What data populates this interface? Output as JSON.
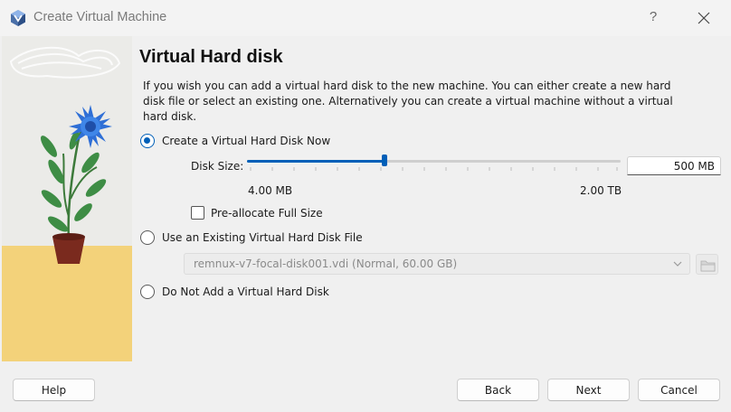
{
  "window": {
    "title": "Create Virtual Machine",
    "help_symbol": "?",
    "icons": {
      "app": "virtualbox-icon",
      "close": "close-icon"
    }
  },
  "page": {
    "heading": "Virtual Hard disk",
    "description": "If you wish you can add a virtual hard disk to the new machine. You can either create a new hard disk file or select an existing one. Alternatively you can create a virtual machine without a virtual hard disk."
  },
  "options": {
    "create_now": {
      "label": "Create a Virtual Hard Disk Now",
      "selected": true
    },
    "use_existing": {
      "label": "Use an Existing Virtual Hard Disk File",
      "selected": false
    },
    "do_not_add": {
      "label": "Do Not Add a Virtual Hard Disk",
      "selected": false
    }
  },
  "disk_size": {
    "label": "Disk Size:",
    "value": "500 MB",
    "min_label": "4.00 MB",
    "max_label": "2.00 TB",
    "slider_fraction": 0.37
  },
  "preallocate": {
    "label": "Pre-allocate Full Size",
    "checked": false
  },
  "existing_disk": {
    "selected": "remnux-v7-focal-disk001.vdi (Normal, 60.00 GB)",
    "folder_icon": "folder-icon"
  },
  "buttons": {
    "help": "Help",
    "back": "Back",
    "next": "Next",
    "cancel": "Cancel"
  },
  "colors": {
    "accent": "#005fb8",
    "flower_blue": "#2f6fd6",
    "floor_yellow": "#f3d27a",
    "pot": "#7a2a1e"
  }
}
